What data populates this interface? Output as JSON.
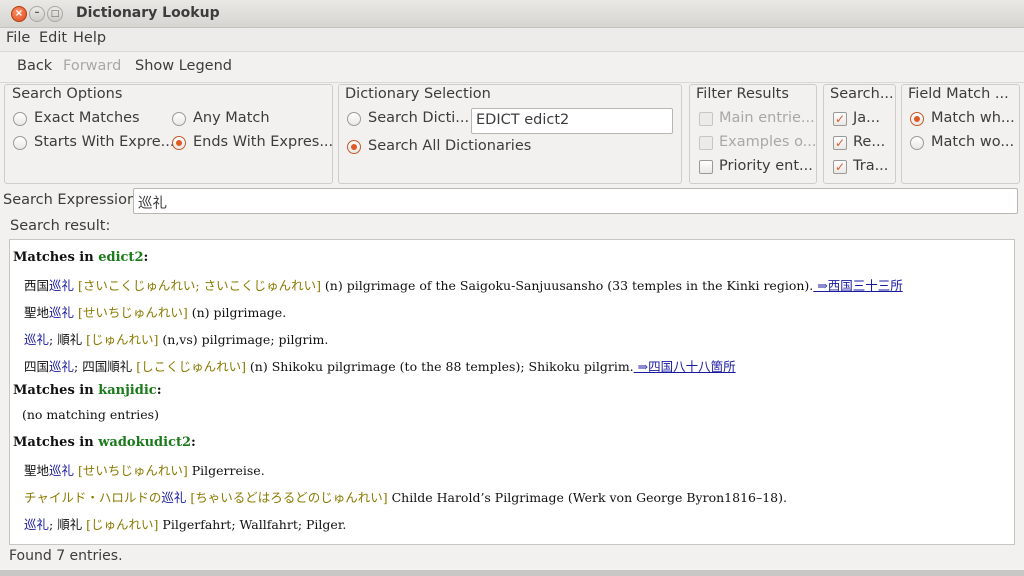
{
  "window": {
    "title": "Dictionary Lookup"
  },
  "menu": [
    "File",
    "Edit",
    "Help"
  ],
  "toolbar": {
    "back": "Back",
    "forward": "Forward",
    "legend": "Show Legend"
  },
  "search_options": {
    "title": "Search Options",
    "exact": "Exact Matches",
    "any": "Any Match",
    "starts": "Starts With Expre...",
    "ends": "Ends With Expres..."
  },
  "dictionary_selection": {
    "title": "Dictionary Selection",
    "single": "Search Dicti...",
    "selected_dict": "EDICT edict2",
    "all": "Search All Dictionaries"
  },
  "filter_results": {
    "title": "Filter Results",
    "main": "Main entrie...",
    "examples": "Examples o...",
    "priority": "Priority ent..."
  },
  "search_fields": {
    "title": "Search...",
    "ja": "Ja...",
    "re": "Re...",
    "tra": "Tra..."
  },
  "field_match": {
    "title": "Field Match ...",
    "whole": "Match wh...",
    "word": "Match wo..."
  },
  "search_expression": {
    "label": "Search Expression:",
    "value": "巡礼"
  },
  "result": {
    "label": "Search result:",
    "edict_head_pre": "Matches in ",
    "edict_name": "edict2",
    "head_colon": ":",
    "e1_pre": "西国",
    "e1_kanji": "巡礼",
    "e1_kana": " [さいこくじゅんれい; さいこくじゅんれい]",
    "e1_text": " (n) pilgrimage of the Saigoku-Sanjuusansho (33 temples in the Kinki region).",
    "e1_link": " ⇒西国三十三所",
    "e2_pre": "聖地",
    "e2_kanji": "巡礼",
    "e2_kana": " [せいちじゅんれい]",
    "e2_text": " (n) pilgrimage.",
    "e3_kanji": "巡礼",
    "e3_mid": "; 順礼",
    "e3_kana": " [じゅんれい]",
    "e3_text": " (n,vs) pilgrimage; pilgrim.",
    "e4_pre": "四国",
    "e4_kanji": "巡礼",
    "e4_mid": "; 四国順礼",
    "e4_kana": " [しこくじゅんれい]",
    "e4_text": " (n) Shikoku pilgrimage (to the 88 temples); Shikoku pilgrim.",
    "e4_link": " ⇒四国八十八箇所",
    "kanjidic_name": "kanjidic",
    "none": "(no matching entries)",
    "wadoku_name": "wadokudict2",
    "w1_pre": "聖地",
    "w1_kanji": "巡礼",
    "w1_kana": " [せいちじゅんれい]",
    "w1_text": " Pilgerreise.",
    "w2_pre": "チャイルド・ハロルドの",
    "w2_kanji": "巡礼",
    "w2_kana": " [ちゃいるどはろるどのじゅんれい]",
    "w2_text": " Childe Harold’s Pilgrimage (Werk von George Byron1816–18).",
    "w3_kanji": "巡礼",
    "w3_mid": "; 順礼",
    "w3_kana": " [じゅんれい]",
    "w3_text": " Pilgerfahrt; Wallfahrt; Pilger."
  },
  "status": "Found 7 entries."
}
